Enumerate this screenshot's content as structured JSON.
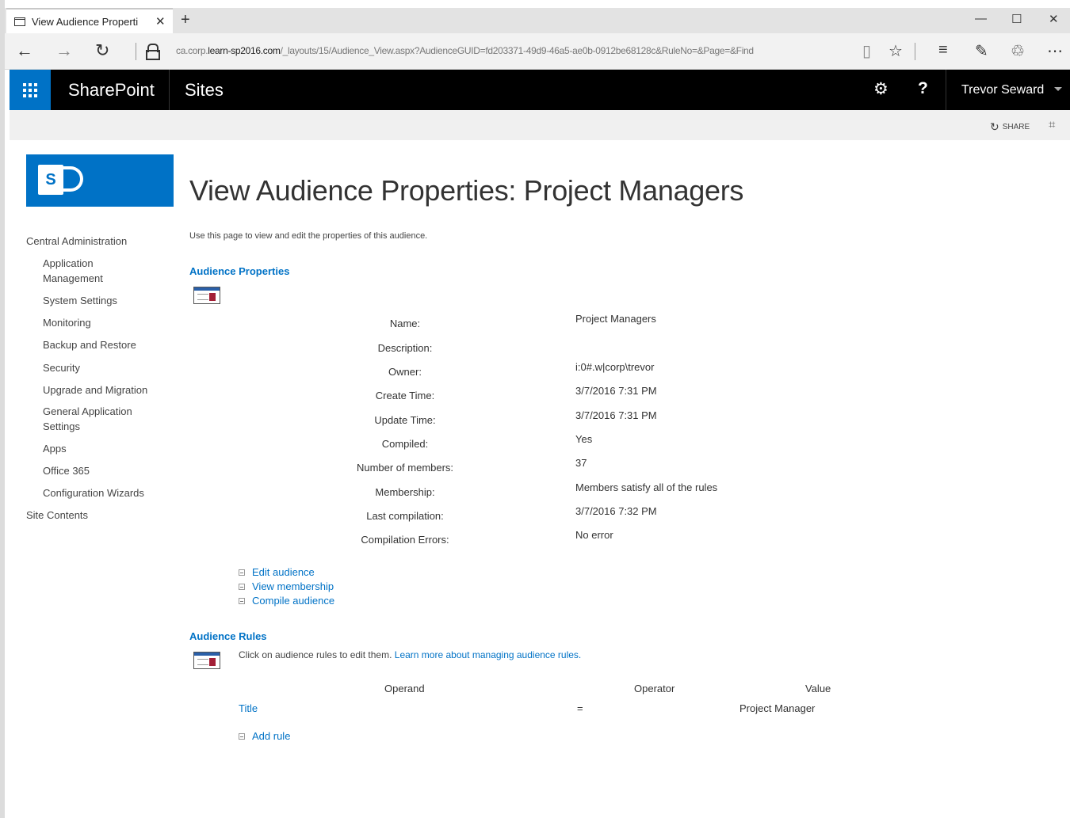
{
  "browser": {
    "tab_title": "View Audience Properti",
    "url_prefix": "ca.corp.",
    "url_domain": "learn-sp2016.com",
    "url_path": "/_layouts/15/Audience_View.aspx?AudienceGUID=fd203371-49d9-46a5-ae0b-0912be68128c&RuleNo=&Page=&Find"
  },
  "suite": {
    "brand": "SharePoint",
    "sites": "Sites",
    "help": "?",
    "user": "Trevor Seward"
  },
  "ribbon": {
    "share": "SHARE"
  },
  "logo": {
    "letter": "S"
  },
  "page": {
    "title": "View Audience Properties: Project Managers",
    "description": "Use this page to view and edit the properties of this audience."
  },
  "left_nav": {
    "root": "Central Administration",
    "items": [
      "Application\nManagement",
      "System Settings",
      "Monitoring",
      "Backup and Restore",
      "Security",
      "Upgrade and Migration",
      "General Application\nSettings",
      "Apps",
      "Office 365",
      "Configuration Wizards"
    ],
    "site_contents": "Site Contents"
  },
  "properties": {
    "heading": "Audience Properties",
    "rows": [
      {
        "label": "Name:",
        "value": "Project Managers"
      },
      {
        "label": "Description:",
        "value": ""
      },
      {
        "label": "Owner:",
        "value": "i:0#.w|corp\\trevor"
      },
      {
        "label": "Create Time:",
        "value": "3/7/2016 7:31 PM"
      },
      {
        "label": "Update Time:",
        "value": "3/7/2016 7:31 PM"
      },
      {
        "label": "Compiled:",
        "value": "Yes"
      },
      {
        "label": "Number of members:",
        "value": "37"
      },
      {
        "label": "Membership:",
        "value": "Members satisfy all of the rules"
      },
      {
        "label": "Last compilation:",
        "value": "3/7/2016 7:32 PM"
      },
      {
        "label": "Compilation Errors:",
        "value": "No error"
      }
    ]
  },
  "actions": [
    "Edit audience",
    "View membership",
    "Compile audience"
  ],
  "rules": {
    "heading": "Audience Rules",
    "note": "Click on audience rules to edit them.",
    "learn_more": "Learn more about managing audience rules.",
    "columns": [
      "Operand",
      "Operator",
      "Value"
    ],
    "rows": [
      {
        "operand": "Title",
        "operator": "=",
        "value": "Project Manager"
      }
    ],
    "add_rule": "Add rule"
  }
}
